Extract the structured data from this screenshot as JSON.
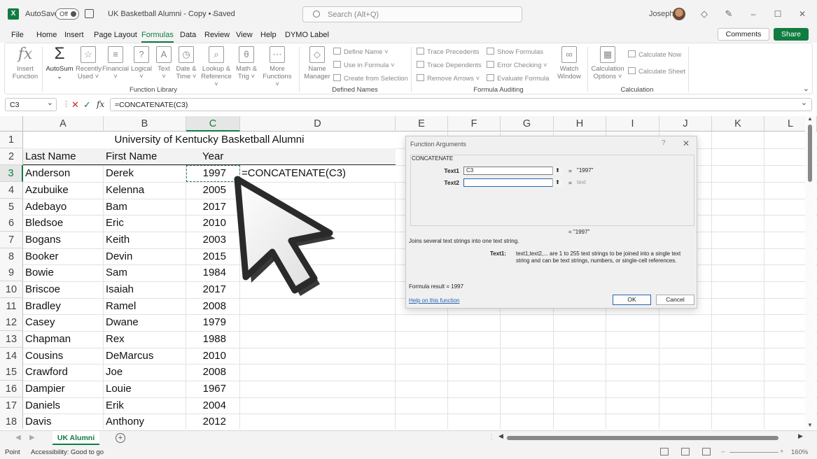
{
  "titlebar": {
    "app_icon": "X",
    "autosave_label": "AutoSave",
    "autosave_state": "Off",
    "document_title": "UK Basketball Alumni - Copy • Saved",
    "search_placeholder": "Search (Alt+Q)",
    "user_name": "Joseph"
  },
  "menu": {
    "tabs": [
      "File",
      "Home",
      "Insert",
      "Page Layout",
      "Formulas",
      "Data",
      "Review",
      "View",
      "Help",
      "DYMO Label"
    ],
    "active": "Formulas",
    "comments_label": "Comments",
    "share_label": "Share"
  },
  "ribbon": {
    "function_library": {
      "label": "Function Library",
      "insert_function": [
        "Insert",
        "Function"
      ],
      "autosum": "AutoSum",
      "recently_used": [
        "Recently",
        "Used ˅"
      ],
      "financial": [
        "Financial",
        "˅"
      ],
      "logical": [
        "Logical",
        "˅"
      ],
      "text": [
        "Text",
        "˅"
      ],
      "date_time": [
        "Date &",
        "Time ˅"
      ],
      "lookup": [
        "Lookup &",
        "Reference ˅"
      ],
      "math_trig": [
        "Math &",
        "Trig ˅"
      ],
      "more": [
        "More",
        "Functions ˅"
      ]
    },
    "defined_names": {
      "label": "Defined Names",
      "name_manager": [
        "Name",
        "Manager"
      ],
      "define_name": "Define Name  ˅",
      "use_in_formula": "Use in Formula ˅",
      "create_from_selection": "Create from Selection"
    },
    "formula_auditing": {
      "label": "Formula Auditing",
      "trace_precedents": "Trace Precedents",
      "trace_dependents": "Trace Dependents",
      "remove_arrows": "Remove Arrows  ˅",
      "show_formulas": "Show Formulas",
      "error_checking": "Error Checking  ˅",
      "evaluate_formula": "Evaluate Formula",
      "watch_window": [
        "Watch",
        "Window"
      ]
    },
    "calculation": {
      "label": "Calculation",
      "options": [
        "Calculation",
        "Options ˅"
      ],
      "calc_now": "Calculate Now",
      "calc_sheet": "Calculate Sheet"
    }
  },
  "formula_bar": {
    "name_box": "C3",
    "formula": "=CONCATENATE(C3)"
  },
  "sheet": {
    "columns": [
      "A",
      "B",
      "C",
      "D",
      "E",
      "F",
      "G",
      "H",
      "I",
      "J",
      "K",
      "L"
    ],
    "selected_column": "C",
    "title": "University of Kentucky Basketball Alumni",
    "headers": [
      "Last Name",
      "First Name",
      "Year"
    ],
    "rows": [
      [
        "Anderson",
        "Derek",
        "1997"
      ],
      [
        "Azubuike",
        "Kelenna",
        "2005"
      ],
      [
        "Adebayo",
        "Bam",
        "2017"
      ],
      [
        "Bledsoe",
        "Eric",
        "2010"
      ],
      [
        "Bogans",
        "Keith",
        "2003"
      ],
      [
        "Booker",
        "Devin",
        "2015"
      ],
      [
        "Bowie",
        "Sam",
        "1984"
      ],
      [
        "Briscoe",
        "Isaiah",
        "2017"
      ],
      [
        "Bradley",
        "Ramel",
        "2008"
      ],
      [
        "Casey",
        "Dwane",
        "1979"
      ],
      [
        "Chapman",
        "Rex",
        "1988"
      ],
      [
        "Cousins",
        "DeMarcus",
        "2010"
      ],
      [
        "Crawford",
        "Joe",
        "2008"
      ],
      [
        "Dampier",
        "Louie",
        "1967"
      ],
      [
        "Daniels",
        "Erik",
        "2004"
      ],
      [
        "Davis",
        "Anthony",
        "2012"
      ]
    ],
    "row_numbers": [
      "1",
      "2",
      "3",
      "4",
      "5",
      "6",
      "7",
      "8",
      "9",
      "10",
      "11",
      "12",
      "13",
      "14",
      "15",
      "16",
      "17",
      "18"
    ],
    "selected_row": "3",
    "editing_text": "=CONCATENATE(C3)"
  },
  "dialog": {
    "title": "Function Arguments",
    "help_glyph": "?",
    "function_name": "CONCATENATE",
    "args": [
      {
        "label": "Text1",
        "value": "C3",
        "eq": "=",
        "result": "\"1997\""
      },
      {
        "label": "Text2",
        "value": "",
        "eq": "=",
        "result": "text"
      }
    ],
    "overall_result": "=  \"1997\"",
    "description": "Joins several text strings into one text string.",
    "arg_name": "Text1:",
    "arg_description": "text1,text2,... are 1 to 255 text strings to be joined into a single text string and can be text strings, numbers, or single-cell references.",
    "formula_result": "Formula result =    1997",
    "help_link": "Help on this function",
    "ok_label": "OK",
    "cancel_label": "Cancel"
  },
  "tabs": {
    "sheet_name": "UK Alumni",
    "add_label": "+"
  },
  "status": {
    "mode": "Point",
    "accessibility": "Accessibility: Good to go",
    "zoom": "160%"
  },
  "colors": {
    "accent": "#107c41",
    "link": "#2a64b0"
  }
}
